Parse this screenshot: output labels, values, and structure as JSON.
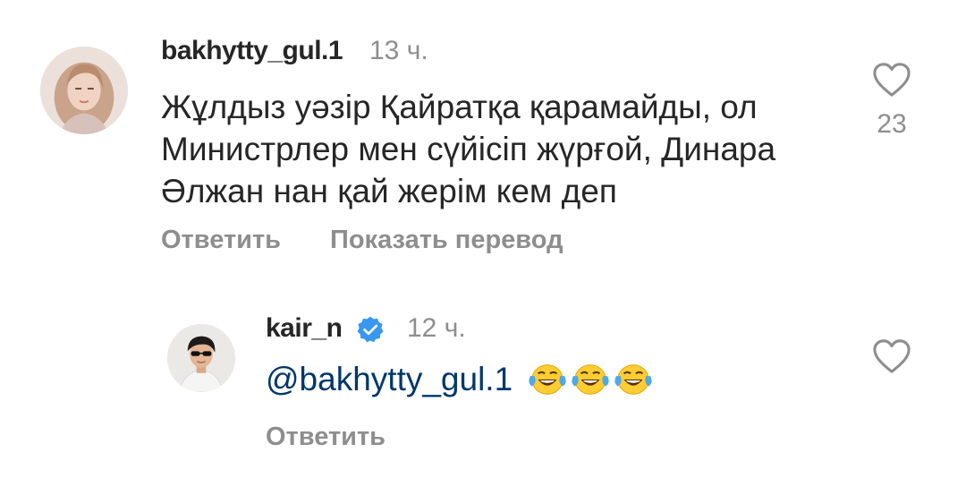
{
  "comments": [
    {
      "username": "bakhytty_gul.1",
      "time": "13 ч.",
      "lines": [
        "Жұлдыз уәзір Қайратқа қарамайды, ол",
        "Министрлер мен сүйісіп жүрғой, Динара",
        "Әлжан нан қай жерім кем деп"
      ],
      "likes": "23",
      "reply_label": "Ответить",
      "translate_label": "Показать перевод",
      "avatar_icon": "user-avatar-woman",
      "like_icon": "heart-outline-icon"
    },
    {
      "username": "kair_n",
      "verified": true,
      "verified_icon": "verified-badge-icon",
      "time": "12 ч.",
      "mention": "@bakhytty_gul.1",
      "emojis": [
        "face-with-tears-of-joy",
        "face-with-tears-of-joy",
        "face-with-tears-of-joy"
      ],
      "reply_label": "Ответить",
      "avatar_icon": "user-avatar-man-sunglasses",
      "like_icon": "heart-outline-icon"
    }
  ],
  "colors": {
    "text": "#262626",
    "secondary": "#8e8e8e",
    "mention": "#00376b",
    "verified": "#3897f0"
  }
}
